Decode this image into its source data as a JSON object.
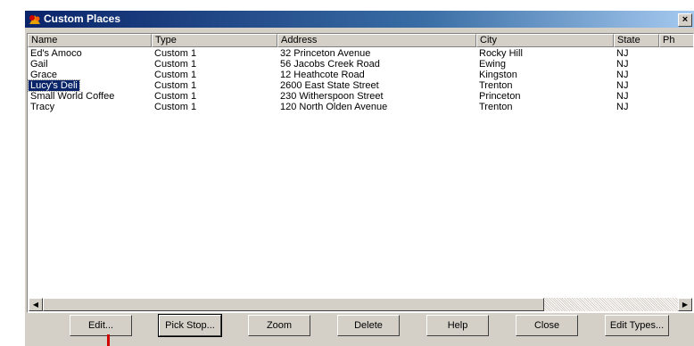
{
  "window": {
    "title": "Custom Places"
  },
  "columns": [
    "Name",
    "Type",
    "Address",
    "City",
    "State",
    "Ph"
  ],
  "rows": [
    [
      "Ed's Amoco",
      "Custom 1",
      "32 Princeton Avenue",
      "Rocky Hill",
      "NJ"
    ],
    [
      "Gail",
      "Custom 1",
      "56 Jacobs Creek Road",
      "Ewing",
      "NJ"
    ],
    [
      "Grace",
      "Custom 1",
      "12 Heathcote Road",
      "Kingston",
      "NJ"
    ],
    [
      "Lucy's Deli",
      "Custom 1",
      "2600 East State Street",
      "Trenton",
      "NJ"
    ],
    [
      "Small World Coffee",
      "Custom 1",
      "230 Witherspoon Street",
      "Princeton",
      "NJ"
    ],
    [
      "Tracy",
      "Custom 1",
      "120 North Olden Avenue",
      "Trenton",
      "NJ"
    ]
  ],
  "selected_row": 3,
  "buttons": {
    "edit": "Edit...",
    "pick_stop": "Pick Stop...",
    "zoom": "Zoom",
    "delete": "Delete",
    "help": "Help",
    "close": "Close",
    "edit_types": "Edit Types..."
  },
  "colors": {
    "title_start": "#0a246a",
    "selection": "#0a246a",
    "face": "#d4d0c8",
    "pointer": "#d00000"
  }
}
